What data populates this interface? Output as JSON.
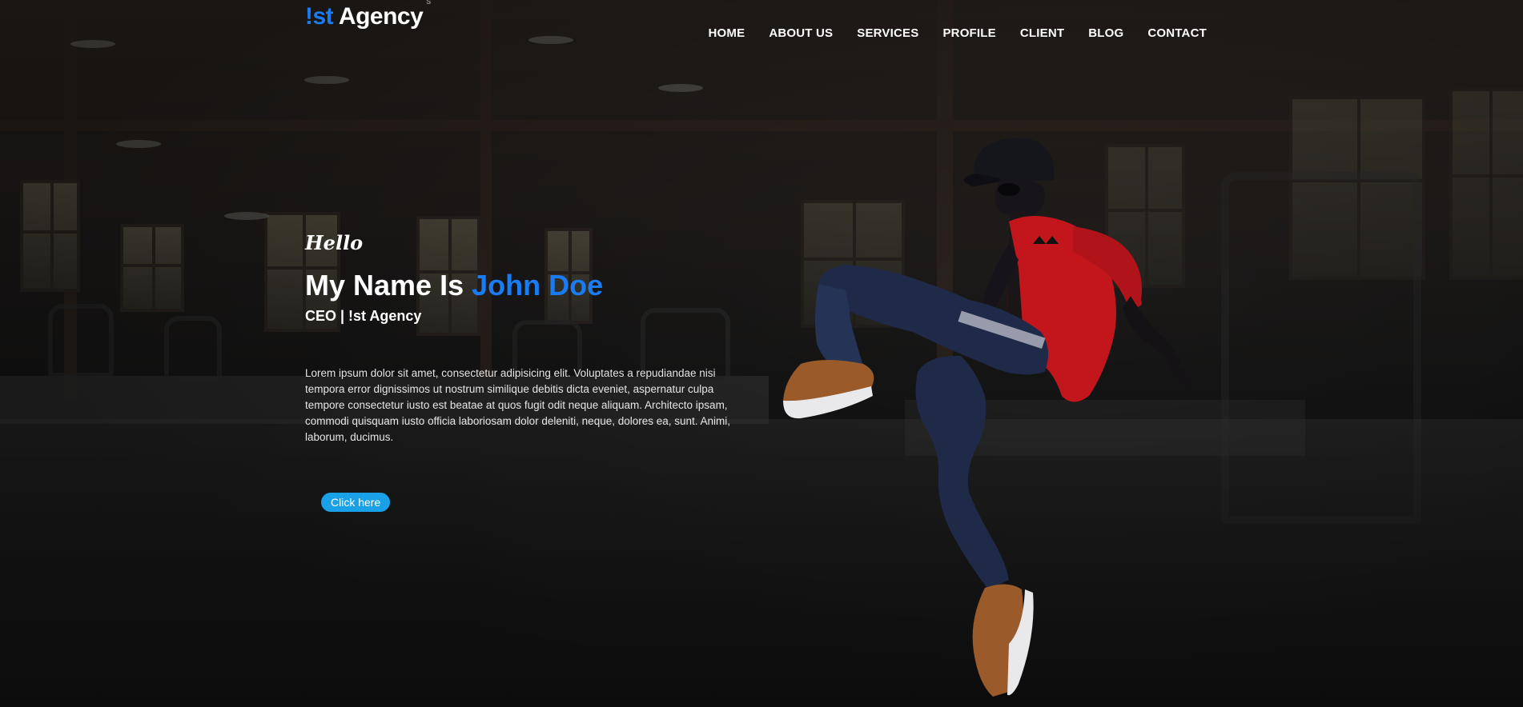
{
  "brand": {
    "logo_accent": "!st",
    "logo_text": "Agency",
    "logo_mark": "S"
  },
  "nav": {
    "items": [
      {
        "label": "HOME"
      },
      {
        "label": "ABOUT US"
      },
      {
        "label": "SERVICES"
      },
      {
        "label": "PROFILE"
      },
      {
        "label": "CLIENT"
      },
      {
        "label": "BLOG"
      },
      {
        "label": "CONTACT"
      }
    ]
  },
  "hero": {
    "greeting": "Hello",
    "headline_prefix": "My Name Is",
    "headline_name": "John Doe",
    "role": "CEO | !st Agency",
    "bio": "Lorem ipsum dolor sit amet, consectetur adipisicing elit. Voluptates a repudiandae nisi tempora error dignissimos ut nostrum similique debitis dicta eveniet, aspernatur culpa tempore consectetur iusto est beatae at quos fugit odit neque aliquam. Architecto ipsam, commodi quisquam iusto officia laboriosam dolor deleniti, neque, dolores ea, sunt. Animi, laborum, ducimus.",
    "cta_label": "Click here"
  },
  "colors": {
    "accent": "#1a7cf0",
    "button": "#1aa0e6",
    "background": "#0c0c0c"
  },
  "images": {
    "background": "blurred-office-interior",
    "hero": "jumping-dancer-red-jacket"
  }
}
